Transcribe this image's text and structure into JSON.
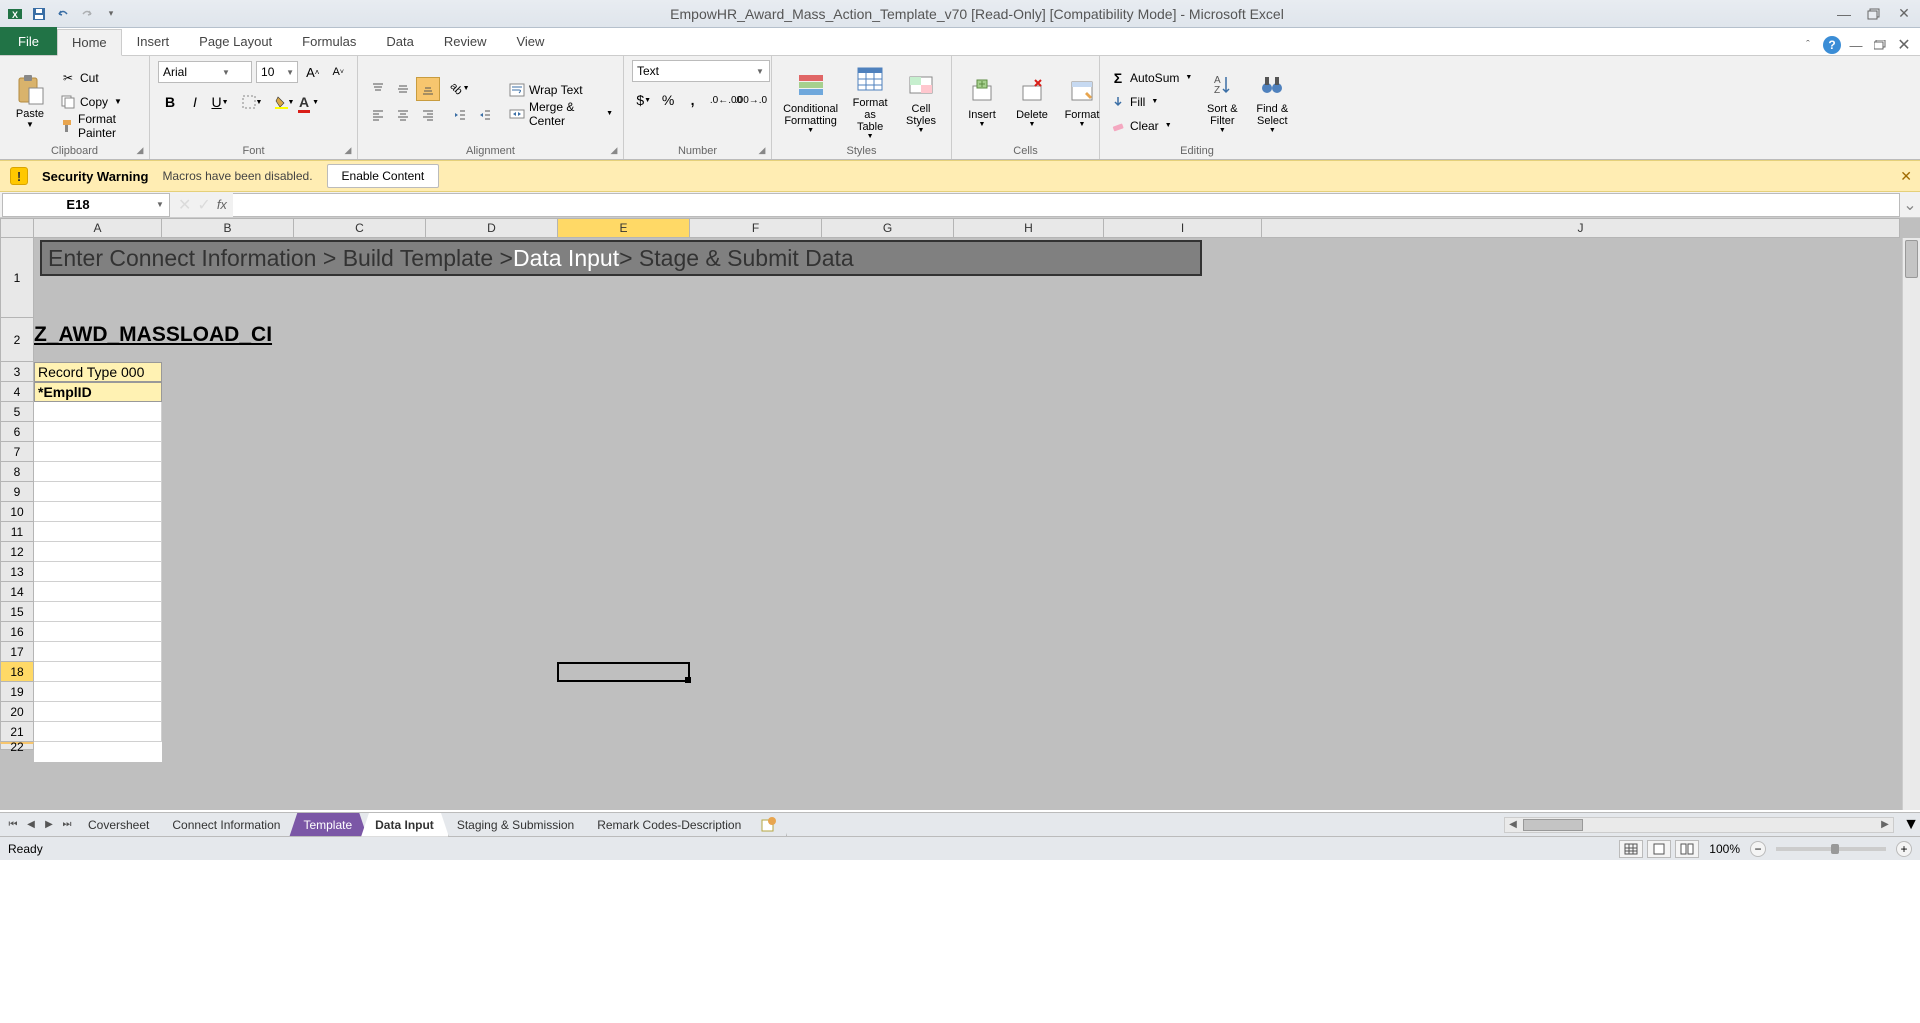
{
  "title": "EmpowHR_Award_Mass_Action_Template_v70  [Read-Only]  [Compatibility Mode] - Microsoft Excel",
  "tabs": {
    "file": "File",
    "home": "Home",
    "insert": "Insert",
    "pageLayout": "Page Layout",
    "formulas": "Formulas",
    "data": "Data",
    "review": "Review",
    "view": "View"
  },
  "clipboard": {
    "paste": "Paste",
    "cut": "Cut",
    "copy": "Copy",
    "formatPainter": "Format Painter",
    "label": "Clipboard"
  },
  "font": {
    "name": "Arial",
    "size": "10",
    "label": "Font"
  },
  "alignment": {
    "wrap": "Wrap Text",
    "merge": "Merge & Center",
    "label": "Alignment"
  },
  "number": {
    "format": "Text",
    "label": "Number"
  },
  "styles": {
    "cond": "Conditional Formatting",
    "table": "Format as Table",
    "cell": "Cell Styles",
    "label": "Styles"
  },
  "cells": {
    "insert": "Insert",
    "delete": "Delete",
    "format": "Format",
    "label": "Cells"
  },
  "editing": {
    "autosum": "AutoSum",
    "fill": "Fill",
    "clear": "Clear",
    "sort": "Sort & Filter",
    "find": "Find & Select",
    "label": "Editing"
  },
  "security": {
    "title": "Security Warning",
    "msg": "Macros have been disabled.",
    "btn": "Enable Content"
  },
  "nameBox": "E18",
  "cols": [
    "A",
    "B",
    "C",
    "D",
    "E",
    "F",
    "G",
    "H",
    "I",
    "J"
  ],
  "rows": [
    "1",
    "2",
    "3",
    "4",
    "5",
    "6",
    "7",
    "8",
    "9",
    "10",
    "11",
    "12",
    "13",
    "14",
    "15",
    "16",
    "17",
    "18",
    "19",
    "20",
    "21",
    "22"
  ],
  "breadcrumb": {
    "p1": "Enter Connect Information > Build Template  > ",
    "active": "Data Input",
    "p2": " > Stage & Submit Data"
  },
  "ciName": "Z_AWD_MASSLOAD_CI",
  "row3": "Record Type 000",
  "row4": "*EmplID",
  "sheetTabs": {
    "cover": "Coversheet",
    "connect": "Connect Information",
    "template": "Template",
    "dataInput": "Data Input",
    "staging": "Staging & Submission",
    "remark": "Remark Codes-Description"
  },
  "statusReady": "Ready",
  "zoom": "100%"
}
